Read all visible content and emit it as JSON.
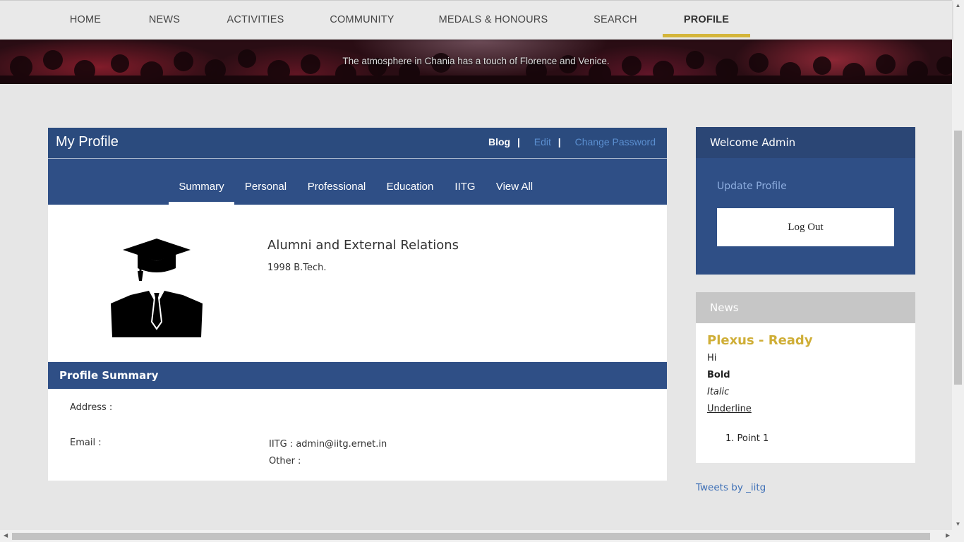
{
  "nav": {
    "items": [
      {
        "label": "HOME",
        "active": false
      },
      {
        "label": "NEWS",
        "active": false
      },
      {
        "label": "ACTIVITIES",
        "active": false
      },
      {
        "label": "COMMUNITY",
        "active": false
      },
      {
        "label": "MEDALS & HONOURS",
        "active": false
      },
      {
        "label": "SEARCH",
        "active": false
      },
      {
        "label": "PROFILE",
        "active": true
      }
    ],
    "accent_color": "#d4b53a"
  },
  "banner": {
    "caption": "The atmosphere in Chania has a touch of Florence and Venice."
  },
  "profile_card": {
    "title": "My Profile",
    "header_links": {
      "blog": "Blog",
      "separator": "|",
      "edit": "Edit",
      "change_password": "Change Password"
    },
    "tabs": [
      {
        "label": "Summary",
        "active": true
      },
      {
        "label": "Personal",
        "active": false
      },
      {
        "label": "Professional",
        "active": false
      },
      {
        "label": "Education",
        "active": false
      },
      {
        "label": "IITG",
        "active": false
      },
      {
        "label": "View All",
        "active": false
      }
    ],
    "avatar_icon": "graduate-avatar-icon",
    "name": "Alumni and External Relations",
    "subtitle": "1998 B.Tech.",
    "summary": {
      "heading": "Profile Summary",
      "address_label": "Address :",
      "email_label": "Email :",
      "iitg_email": "IITG : admin@iitg.ernet.in",
      "other_email": "Other :"
    },
    "header_color": "#2b4b7e",
    "tab_color": "#2f4f86"
  },
  "sidebar": {
    "welcome": "Welcome Admin",
    "update_profile": "Update Profile",
    "logout": "Log Out",
    "news": {
      "heading": "News",
      "title": "Plexus - Ready",
      "lines": {
        "hi": "Hi",
        "bold": "Bold",
        "italic": "Italic",
        "underline": "Underline",
        "point": "1. Point 1"
      },
      "title_color": "#cfae37"
    },
    "tweets": "Tweets by _iitg"
  }
}
